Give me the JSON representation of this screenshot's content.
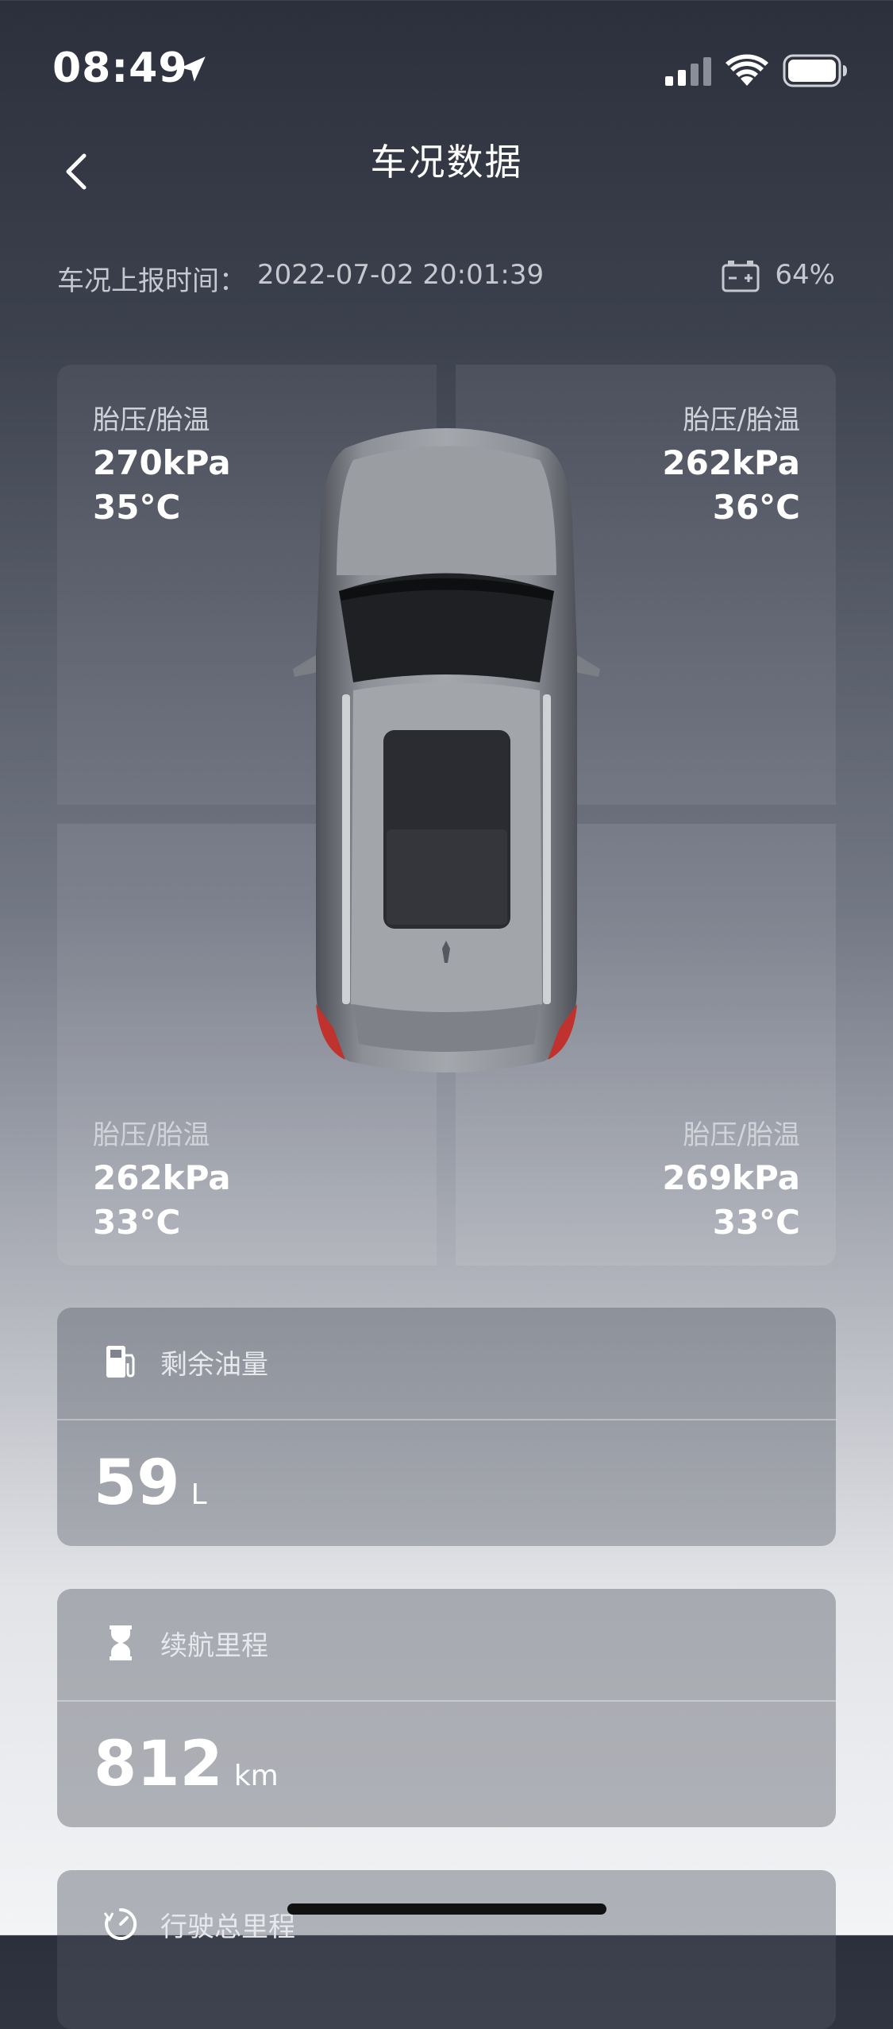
{
  "status_bar": {
    "time": "08:49",
    "icons": [
      "location-arrow-icon",
      "cellular-signal-icon",
      "wifi-icon",
      "battery-icon"
    ]
  },
  "nav": {
    "title": "车况数据",
    "back_icon": "chevron-left-icon"
  },
  "report": {
    "label": "车况上报时间：",
    "time": "2022-07-02 20:01:39",
    "battery_icon": "car-battery-icon",
    "battery_percent": "64%"
  },
  "tires": {
    "front_left": {
      "label": "胎压/胎温",
      "pressure": "270kPa",
      "temp": "35°C"
    },
    "front_right": {
      "label": "胎压/胎温",
      "pressure": "262kPa",
      "temp": "36°C"
    },
    "rear_left": {
      "label": "胎压/胎温",
      "pressure": "262kPa",
      "temp": "33°C"
    },
    "rear_right": {
      "label": "胎压/胎温",
      "pressure": "269kPa",
      "temp": "33°C"
    }
  },
  "fuel": {
    "icon": "fuel-pump-icon",
    "title": "剩余油量",
    "value": "59",
    "unit": "L"
  },
  "range": {
    "icon": "hourglass-icon",
    "title": "续航里程",
    "value": "812",
    "unit": "km"
  },
  "odometer": {
    "icon": "odometer-icon",
    "title": "行驶总里程"
  },
  "colors": {
    "background_top": "#2c303c",
    "background_bottom": "#f3f4f6",
    "text_primary": "#ffffff",
    "text_secondary": "#c5c8cf"
  }
}
